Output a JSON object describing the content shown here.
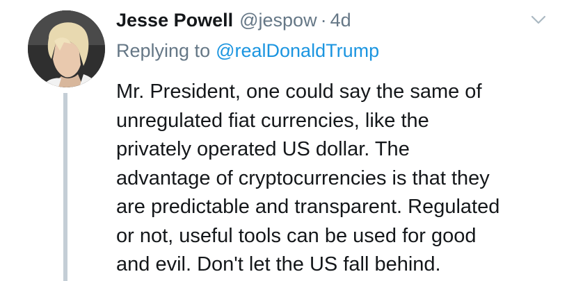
{
  "tweet": {
    "author_name": "Jesse Powell",
    "author_handle": "@jespow",
    "separator": "·",
    "timestamp": "4d",
    "replying_prefix": "Replying to",
    "replying_to": "@realDonaldTrump",
    "body_lines": [
      "Mr. President, one could say the same of",
      "unregulated fiat currencies, like the",
      "privately operated US dollar. The",
      "advantage of cryptocurrencies is that they",
      "are predictable and transparent. Regulated",
      "or not, useful tools can be used for good",
      "and evil. Don't let the US fall behind."
    ]
  },
  "icons": {
    "menu": "chevron-down-icon",
    "avatar": "user-avatar"
  },
  "colors": {
    "text": "#14171a",
    "muted": "#657786",
    "link": "#1b95e0",
    "thread_line": "#c4ced6"
  }
}
